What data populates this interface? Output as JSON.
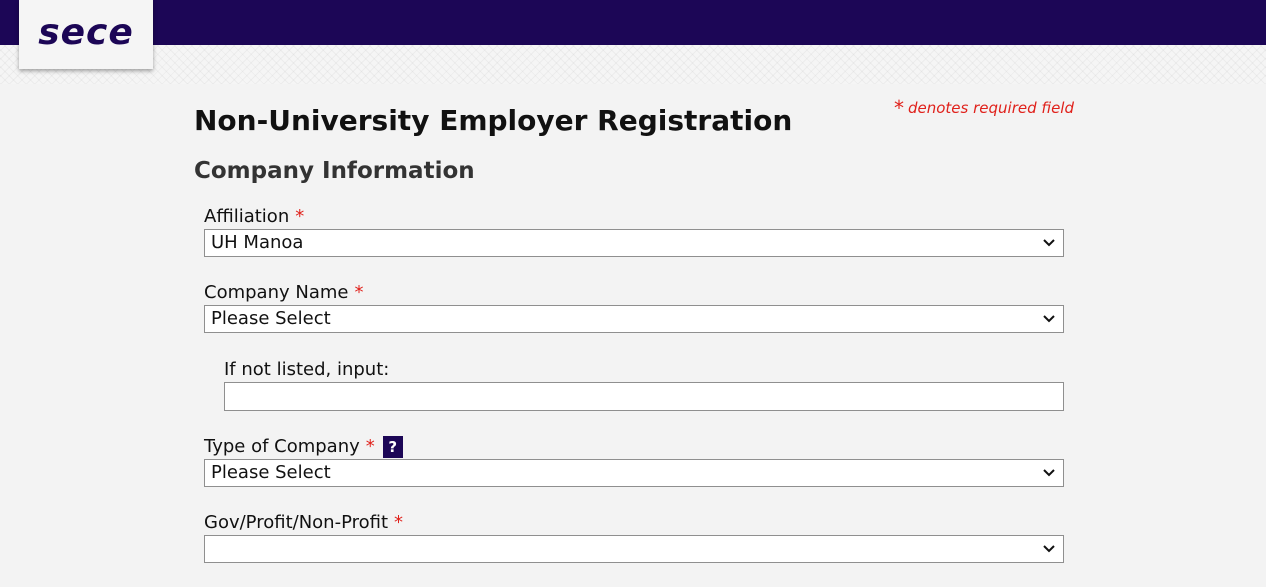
{
  "header": {
    "logo_text": "sece"
  },
  "page": {
    "required_note": "denotes required field",
    "required_star": "*",
    "title": "Non-University Employer Registration",
    "section_title": "Company Information"
  },
  "fields": {
    "affiliation": {
      "label": "Affiliation",
      "value": "UH Manoa"
    },
    "company_name": {
      "label": "Company Name",
      "value": "Please Select"
    },
    "not_listed": {
      "label": "If not listed, input:",
      "value": ""
    },
    "company_type": {
      "label": "Type of Company",
      "value": "Please Select",
      "help": "?"
    },
    "gov_profit": {
      "label": "Gov/Profit/Non-Profit",
      "value": ""
    }
  },
  "colors": {
    "brand": "#1c0656",
    "required": "#e0211b",
    "background": "#f3f3f3"
  },
  "icons": {
    "dropdown": "chevron-down-icon",
    "help": "help-icon"
  }
}
